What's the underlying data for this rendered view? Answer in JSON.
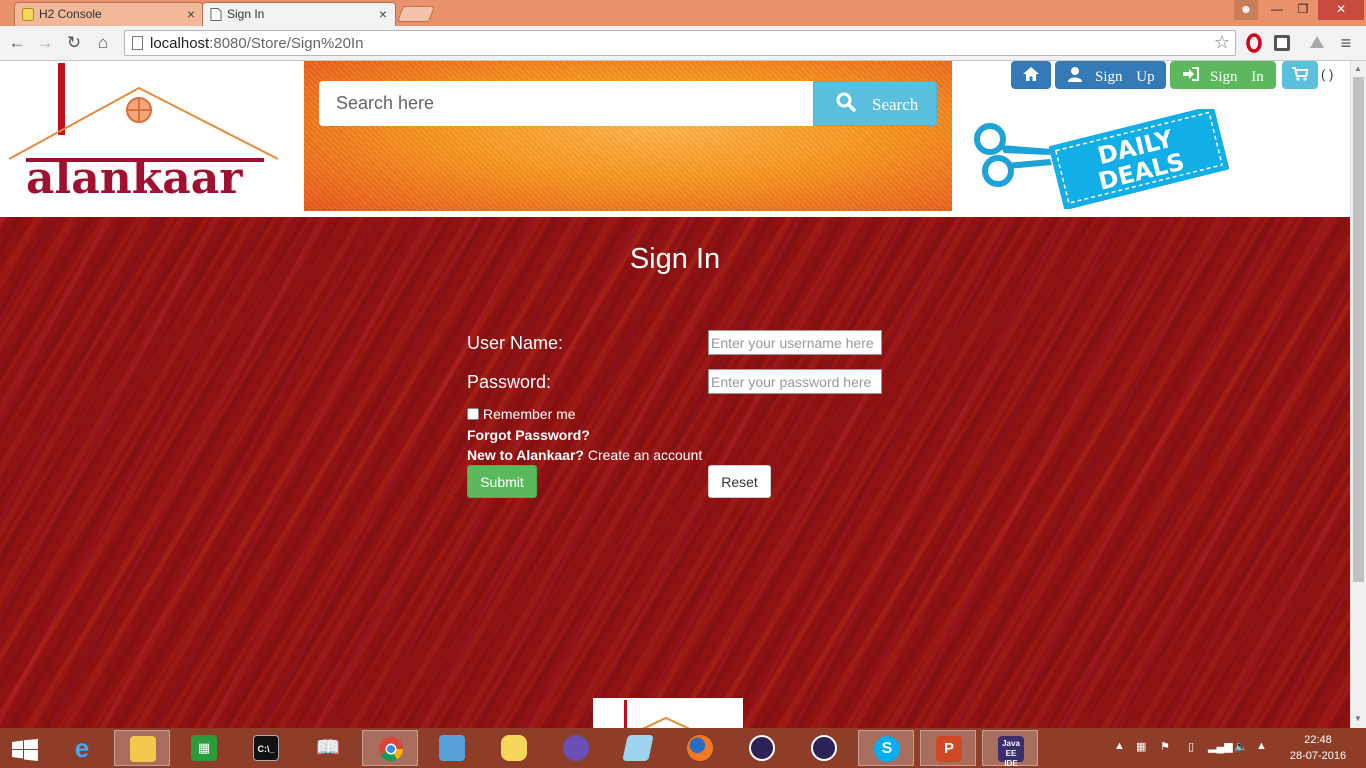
{
  "browser": {
    "tabs": [
      {
        "title": "H2 Console",
        "active": false
      },
      {
        "title": "Sign In",
        "active": true
      }
    ],
    "url_host": "localhost",
    "url_rest": ":8080/Store/Sign%20In"
  },
  "header": {
    "brand": "alankaar",
    "search_placeholder": "Search here",
    "search_button": "Search",
    "signup_label": "Sign Up",
    "signin_label": "Sign In",
    "cart_count": "( )",
    "deals_line1": "DAILY",
    "deals_line2": "DEALS"
  },
  "signin": {
    "title": "Sign In",
    "username_label": "User Name:",
    "username_placeholder": "Enter your username here",
    "password_label": "Password:",
    "password_placeholder": "Enter your password here",
    "remember_label": "Remember me",
    "forgot_label": "Forgot Password?",
    "new_question": "New to Alankaar?",
    "create_account": "Create an account",
    "submit_label": "Submit",
    "reset_label": "Reset"
  },
  "taskbar": {
    "apps": [
      "start",
      "internet-explorer",
      "file-explorer",
      "store",
      "command-prompt",
      "reader",
      "chrome",
      "remote-desktop",
      "database",
      "kitty",
      "notepad",
      "firefox",
      "eclipse",
      "eclipse",
      "skype",
      "powerpoint",
      "java-ee-ide"
    ],
    "active_app": "chrome",
    "time": "22:48",
    "date": "28-07-2016"
  },
  "colors": {
    "titlebar": "#e8916b",
    "primary": "#337ab7",
    "success": "#5cb85c",
    "info": "#5bc0de",
    "page_bg": "#8e1212",
    "taskbar": "#8d3d28",
    "brand": "#a01030"
  }
}
